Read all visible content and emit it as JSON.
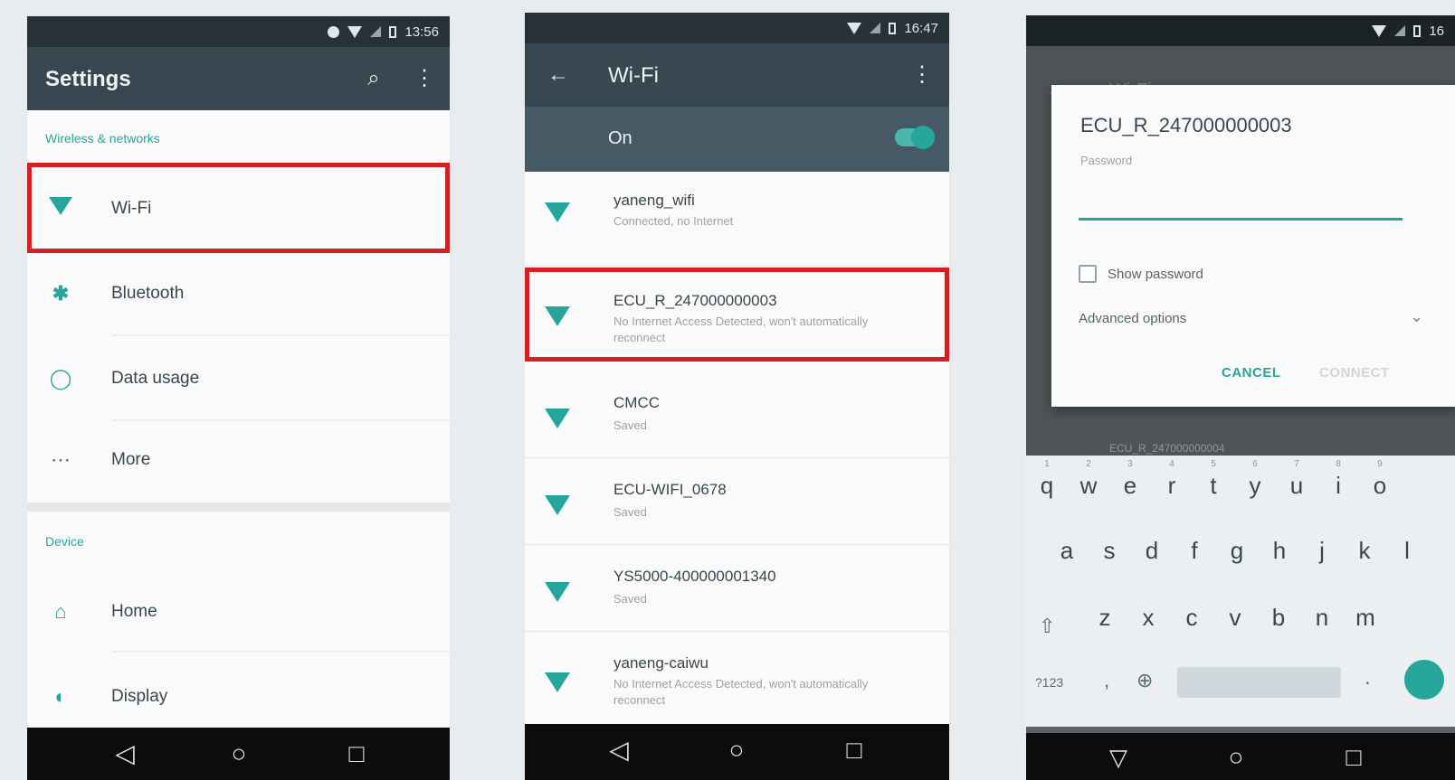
{
  "colors": {
    "accent": "#26a69a",
    "toolbar": "#37474f",
    "highlight": "#d32027",
    "navbar": "#0c0c0c"
  },
  "p1": {
    "status_time": "13:56",
    "title": "Settings",
    "search_icon": "search-icon",
    "more_icon": "more-vert-icon",
    "section_wireless": "Wireless & networks",
    "items": [
      {
        "label": "Wi-Fi",
        "icon": "wifi-icon"
      },
      {
        "label": "Bluetooth",
        "icon": "bluetooth-icon"
      },
      {
        "label": "Data usage",
        "icon": "data-usage-icon"
      },
      {
        "label": "More",
        "icon": "more-horiz-icon"
      }
    ],
    "section_device": "Device",
    "device_items": [
      {
        "label": "Home",
        "icon": "home-icon"
      },
      {
        "label": "Display",
        "icon": "display-icon"
      }
    ]
  },
  "p2": {
    "status_time": "16:47",
    "title": "Wi-Fi",
    "toggle_label": "On",
    "toggle_on": true,
    "networks": [
      {
        "name": "yaneng_wifi",
        "status": "Connected, no Internet"
      },
      {
        "name": "ECU_R_247000000003",
        "status": "No Internet Access Detected, won't automatically reconnect"
      },
      {
        "name": "CMCC",
        "status": "Saved"
      },
      {
        "name": "ECU-WIFI_0678",
        "status": "Saved"
      },
      {
        "name": "YS5000-400000001340",
        "status": "Saved"
      },
      {
        "name": "yaneng-caiwu",
        "status": "No Internet Access Detected, won't automatically reconnect"
      }
    ]
  },
  "p3": {
    "status_time": "16",
    "behind_title": "Wi-Fi",
    "dialog": {
      "title": "ECU_R_247000000003",
      "password_label": "Password",
      "password_value": "",
      "show_password": "Show password",
      "advanced": "Advanced options",
      "cancel": "CANCEL",
      "connect": "CONNECT"
    },
    "behind_peek": "ECU_R_247000000004",
    "keyboard": {
      "row1": [
        "q",
        "w",
        "e",
        "r",
        "t",
        "y",
        "u",
        "i",
        "o"
      ],
      "row1_hints": [
        "1",
        "2",
        "3",
        "4",
        "5",
        "6",
        "7",
        "8",
        "9"
      ],
      "row2": [
        "a",
        "s",
        "d",
        "f",
        "g",
        "h",
        "j",
        "k",
        "l"
      ],
      "row3": [
        "z",
        "x",
        "c",
        "v",
        "b",
        "n",
        "m"
      ],
      "symbols": "?123",
      "comma": ",",
      "period": "."
    }
  }
}
